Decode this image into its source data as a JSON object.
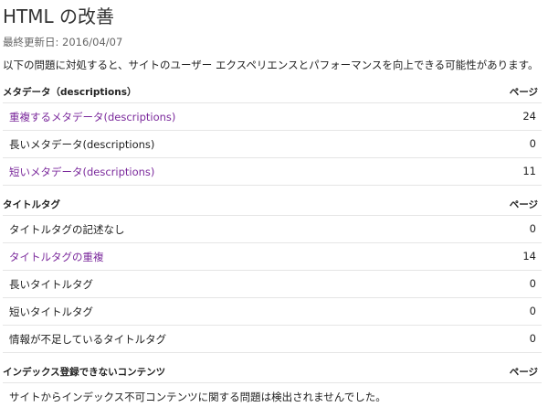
{
  "header": {
    "title": "HTML の改善",
    "last_updated": "最終更新日: 2016/04/07",
    "intro": "以下の問題に対処すると、サイトのユーザー エクスペリエンスとパフォーマンスを向上できる可能性があります。"
  },
  "sections": [
    {
      "heading": "メタデータ（descriptions）",
      "column": "ページ",
      "rows": [
        {
          "label": "重複するメタデータ(descriptions)",
          "value": "24",
          "link": true
        },
        {
          "label": "長いメタデータ(descriptions)",
          "value": "0",
          "link": false
        },
        {
          "label": "短いメタデータ(descriptions)",
          "value": "11",
          "link": true
        }
      ]
    },
    {
      "heading": "タイトルタグ",
      "column": "ページ",
      "rows": [
        {
          "label": "タイトルタグの記述なし",
          "value": "0",
          "link": false
        },
        {
          "label": "タイトルタグの重複",
          "value": "14",
          "link": true
        },
        {
          "label": "長いタイトルタグ",
          "value": "0",
          "link": false
        },
        {
          "label": "短いタイトルタグ",
          "value": "0",
          "link": false
        },
        {
          "label": "情報が不足しているタイトルタグ",
          "value": "0",
          "link": false
        }
      ]
    },
    {
      "heading": "インデックス登録できないコンテンツ",
      "column": "ページ",
      "message": "サイトからインデックス不可コンテンツに関する問題は検出されませんでした。"
    }
  ],
  "colors": {
    "link": "#7b2a9c",
    "divider": "#e5e5e5",
    "text": "#222222"
  }
}
